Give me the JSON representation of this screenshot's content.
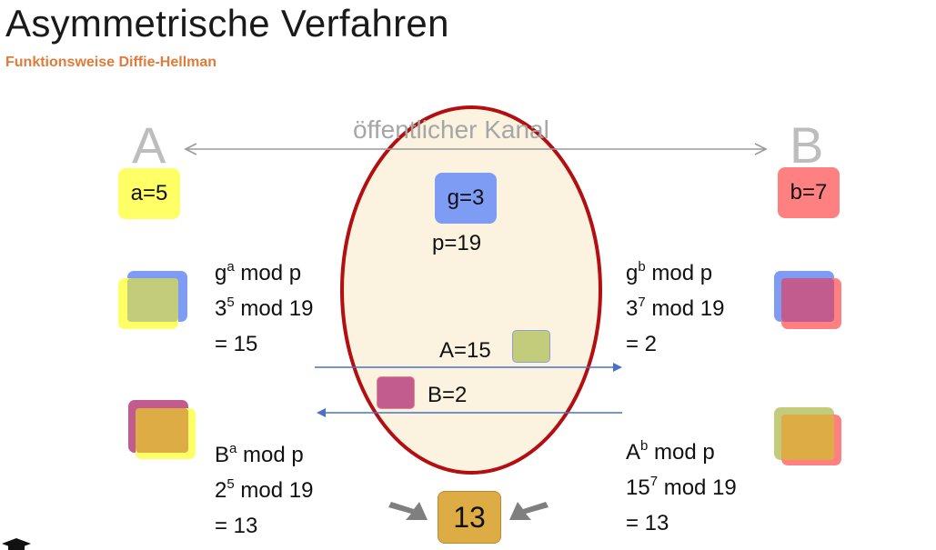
{
  "slide": {
    "title": "Asymmetrische Verfahren",
    "subtitle": "Funktionsweise Diffie-Hellman"
  },
  "diagram": {
    "party_a": "A",
    "party_b": "B",
    "channel_label": "öffentlicher Kanal",
    "private_a": "a=5",
    "private_b": "b=7",
    "public_g": "g=3",
    "public_p": "p=19",
    "a_calc": {
      "base": "g",
      "exp": "a",
      "rest": " mod p",
      "base2": "3",
      "exp2": "5",
      "rest2": " mod 19",
      "result": "= 15"
    },
    "b_calc": {
      "base": "g",
      "exp": "b",
      "rest": " mod p",
      "base2": "3",
      "exp2": "7",
      "rest2": " mod 19",
      "result": "= 2"
    },
    "msg_a": "A=15",
    "msg_b": "B=2",
    "a_key": {
      "base": "B",
      "exp": "a",
      "rest": " mod p",
      "base2": "2",
      "exp2": "5",
      "rest2": " mod 19",
      "result": "= 13"
    },
    "b_key": {
      "base": "A",
      "exp": "b",
      "rest": " mod p",
      "base2": "15",
      "exp2": "7",
      "rest2": " mod 19",
      "result": "= 13"
    },
    "shared_secret": "13"
  },
  "colors": {
    "yellow": "#ffff66",
    "blue": "#7f9cf5",
    "red": "#ff8080",
    "green_mix": "#c3cc7a",
    "magenta_mix": "#c25c8f",
    "orange_mix": "#deac45",
    "ellipse_stroke": "#b30e12",
    "ellipse_fill": "#fbf3e0",
    "arrow_blue": "#4a72c4",
    "title_accent": "#e07b39"
  },
  "icons": {
    "left_arrow": "arrow-right-icon",
    "right_arrow": "arrow-left-icon",
    "corner": "graduation-cap-icon"
  }
}
